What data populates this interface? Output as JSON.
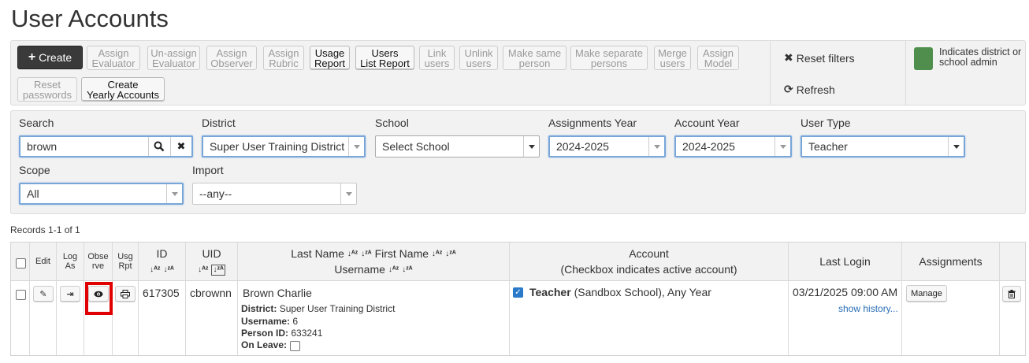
{
  "page": {
    "title": "User Accounts"
  },
  "toolbar": {
    "create": "Create",
    "buttons": [
      {
        "l1": "Assign",
        "l2": "Evaluator",
        "active": false
      },
      {
        "l1": "Un-assign",
        "l2": "Evaluator",
        "active": false
      },
      {
        "l1": "Assign",
        "l2": "Observer",
        "active": false
      },
      {
        "l1": "Assign",
        "l2": "Rubric",
        "active": false
      },
      {
        "l1": "Usage",
        "l2": "Report",
        "active": true
      },
      {
        "l1": "Users",
        "l2": "List Report",
        "active": true
      },
      {
        "l1": "Link",
        "l2": "users",
        "active": false
      },
      {
        "l1": "Unlink",
        "l2": "users",
        "active": false
      },
      {
        "l1": "Make same",
        "l2": "person",
        "active": false
      },
      {
        "l1": "Make separate",
        "l2": "persons",
        "active": false
      },
      {
        "l1": "Merge",
        "l2": "users",
        "active": false
      },
      {
        "l1": "Assign",
        "l2": "Model",
        "active": false
      },
      {
        "l1": "Reset",
        "l2": "passwords",
        "active": false
      },
      {
        "l1": "Create",
        "l2": "Yearly Accounts",
        "active": true
      }
    ],
    "reset_filters": "Reset filters",
    "refresh": "Refresh",
    "legend": "Indicates district or school admin",
    "legend_color": "#4f8e4d"
  },
  "filters": {
    "search_label": "Search",
    "search_value": "brown",
    "district_label": "District",
    "district_value": "Super User Training District",
    "school_label": "School",
    "school_value": "Select School",
    "assign_year_label": "Assignments Year",
    "assign_year_value": "2024-2025",
    "account_year_label": "Account Year",
    "account_year_value": "2024-2025",
    "user_type_label": "User Type",
    "user_type_value": "Teacher",
    "scope_label": "Scope",
    "scope_value": "All",
    "import_label": "Import",
    "import_value": "--any--"
  },
  "records": "Records 1-1 of 1",
  "table": {
    "headers": {
      "edit": "Edit",
      "log1": "Log",
      "log2": "As",
      "obs1": "Obse",
      "obs2": "rve",
      "usg1": "Usg",
      "usg2": "Rpt",
      "id": "ID",
      "uid": "UID",
      "last_name": "Last Name",
      "first_name": "First Name",
      "username": "Username",
      "account1": "Account",
      "account2": "(Checkbox indicates active account)",
      "last_login": "Last Login",
      "assignments": "Assignments"
    },
    "row": {
      "id": "617305",
      "uid": "cbrownn",
      "name": "Brown  Charlie",
      "district_label": "District:",
      "district": "Super User Training District",
      "username_label": "Username:",
      "username": "6",
      "person_id_label": "Person ID:",
      "person_id": "633241",
      "on_leave_label": "On Leave:",
      "account_role": "Teacher",
      "account_detail": "(Sandbox School), Any Year",
      "last_login": "03/21/2025 09:00 AM",
      "show_history": "show history...",
      "manage": "Manage"
    }
  }
}
